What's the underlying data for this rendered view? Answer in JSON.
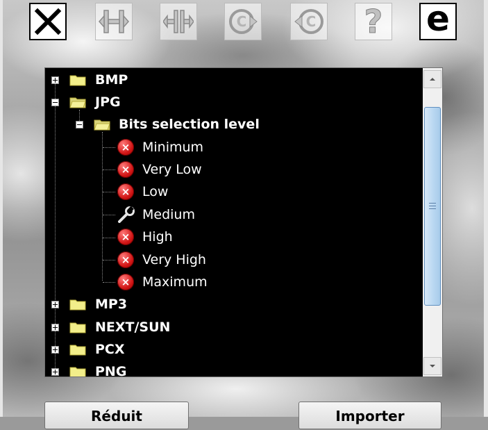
{
  "toolbar": {
    "buttons": [
      {
        "name": "close",
        "icon": "close-x-icon",
        "state": "active"
      },
      {
        "name": "expand",
        "icon": "expand-arrows-icon",
        "state": "disabled"
      },
      {
        "name": "collapse",
        "icon": "collapse-arrows-icon",
        "state": "disabled"
      },
      {
        "name": "forward",
        "icon": "copyright-forward-icon",
        "state": "disabled"
      },
      {
        "name": "back",
        "icon": "copyright-back-icon",
        "state": "disabled"
      },
      {
        "name": "help",
        "icon": "question-icon",
        "label": "?",
        "state": "disabled"
      },
      {
        "name": "edit",
        "icon": "letter-e-icon",
        "label": "e",
        "state": "active"
      }
    ]
  },
  "tree": {
    "items": [
      {
        "label": "BMP",
        "type": "folder",
        "expanded": false,
        "depth": 0
      },
      {
        "label": "JPG",
        "type": "folder",
        "expanded": true,
        "depth": 0
      },
      {
        "label": "Bits selection level",
        "type": "folder",
        "expanded": true,
        "depth": 1
      },
      {
        "label": "Minimum",
        "type": "option",
        "icon": "error-icon",
        "depth": 2
      },
      {
        "label": "Very Low",
        "type": "option",
        "icon": "error-icon",
        "depth": 2
      },
      {
        "label": "Low",
        "type": "option",
        "icon": "error-icon",
        "depth": 2
      },
      {
        "label": "Medium",
        "type": "option",
        "icon": "wrench-icon",
        "depth": 2
      },
      {
        "label": "High",
        "type": "option",
        "icon": "error-icon",
        "depth": 2
      },
      {
        "label": "Very High",
        "type": "option",
        "icon": "error-icon",
        "depth": 2
      },
      {
        "label": "Maximum",
        "type": "option",
        "icon": "error-icon",
        "depth": 2
      },
      {
        "label": "MP3",
        "type": "folder",
        "expanded": false,
        "depth": 0
      },
      {
        "label": "NEXT/SUN",
        "type": "folder",
        "expanded": false,
        "depth": 0
      },
      {
        "label": "PCX",
        "type": "folder",
        "expanded": false,
        "depth": 0
      },
      {
        "label": "PNG",
        "type": "folder",
        "expanded": false,
        "depth": 0
      }
    ]
  },
  "buttons": {
    "left_label": "Réduit",
    "right_label": "Importer"
  },
  "colors": {
    "tree_bg": "#000000",
    "folder": "#f2ee8a",
    "error": "#d11515",
    "scroll_thumb": "#bcd9f2"
  }
}
